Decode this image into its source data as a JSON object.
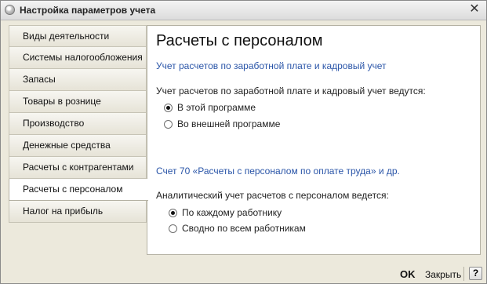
{
  "window": {
    "title": "Настройка параметров учета",
    "close_glyph": "✕"
  },
  "sidebar": {
    "items": [
      {
        "label": "Виды деятельности"
      },
      {
        "label": "Системы налогообложения"
      },
      {
        "label": "Запасы"
      },
      {
        "label": "Товары в рознице"
      },
      {
        "label": "Производство"
      },
      {
        "label": "Денежные средства"
      },
      {
        "label": "Расчеты с контрагентами"
      },
      {
        "label": "Расчеты с персоналом"
      },
      {
        "label": "Налог на прибыль"
      }
    ],
    "active_index": 7
  },
  "main": {
    "title": "Расчеты с персоналом",
    "link1": "Учет расчетов по заработной плате и кадровый учет",
    "question1": "Учет расчетов по заработной плате и кадровый учет ведутся:",
    "radio_group1": [
      {
        "label": "В этой программе",
        "checked": true
      },
      {
        "label": "Во внешней программе",
        "checked": false
      }
    ],
    "link2": "Счет 70 «Расчеты с персоналом по оплате труда» и др.",
    "question2": "Аналитический учет расчетов с персоналом ведется:",
    "radio_group2": [
      {
        "label": "По каждому работнику",
        "checked": true
      },
      {
        "label": "Сводно по всем работникам",
        "checked": false
      }
    ]
  },
  "footer": {
    "ok_label": "OK",
    "close_label": "Закрыть",
    "help_label": "?"
  }
}
